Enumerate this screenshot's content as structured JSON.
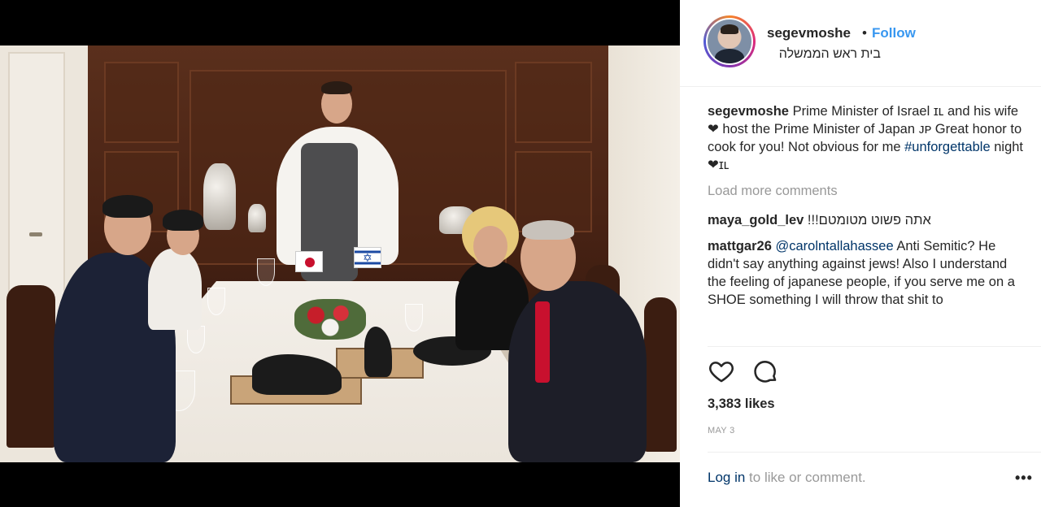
{
  "post": {
    "username": "segevmoshe",
    "separator": "•",
    "follow_label": "Follow",
    "location": "בית ראש הממשלה"
  },
  "caption": {
    "username": "segevmoshe",
    "text_part1": "Prime Minister of Israel ɪʟ and his wife ❤ host the Prime Minister of Japan ᴊᴘ Great honor to cook for you! Not obvious for me ",
    "hashtag": "#unforgettable",
    "text_part2": " night ❤ɪʟ"
  },
  "load_more_label": "Load more comments",
  "comments": [
    {
      "username": "maya_gold_lev",
      "text": "אתה פשוט מטומטם!!!"
    },
    {
      "username": "mattgar26",
      "mention": "@carolntallahassee",
      "text": " Anti Semitic? He didn't say anything against jews! Also I understand the feeling of japanese people, if you serve me on a SHOE something I will throw that shit to"
    }
  ],
  "icons": {
    "like": "heart-icon",
    "comment": "comment-bubble-icon",
    "more": "more-options-icon"
  },
  "likes_label": "3,383 likes",
  "date_label": "MAY 3",
  "login": {
    "link": "Log in",
    "rest": " to like or comment."
  },
  "more_label": "•••",
  "colors": {
    "link_blue": "#3897f0",
    "hashtag": "#003569",
    "muted": "#999999",
    "text": "#262626"
  }
}
